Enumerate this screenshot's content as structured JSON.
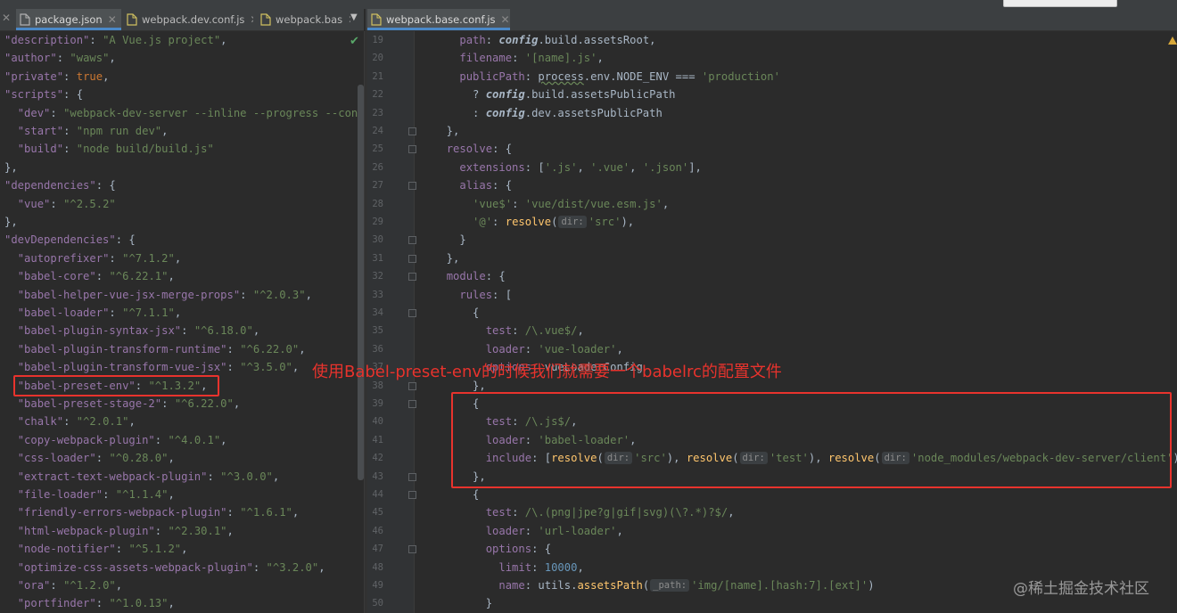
{
  "tabs_left": [
    {
      "label": "package.json",
      "icon": "json-file-icon",
      "active": true
    },
    {
      "label": "webpack.dev.conf.js",
      "icon": "js-file-icon",
      "active": false
    },
    {
      "label": "webpack.bas",
      "icon": "js-file-icon",
      "active": false
    }
  ],
  "tabs_right": [
    {
      "label": "webpack.base.conf.js",
      "icon": "js-file-icon",
      "active": true
    }
  ],
  "icons": {
    "close": "close-icon",
    "overflow": "chevron-down-icon",
    "check": "check-icon",
    "warning": "warning-icon"
  },
  "colors": {
    "background": "#2b2b2b",
    "key": "#9876aa",
    "string": "#6a8759",
    "keyword": "#cc7832",
    "number": "#6897bb",
    "function": "#ffc66d",
    "annotation": "#e8332d"
  },
  "editor_left": {
    "lines": [
      [
        [
          "k",
          "\"description\""
        ],
        [
          "p",
          ": "
        ],
        [
          "s",
          "\"A Vue.js project\""
        ],
        [
          "p",
          ","
        ]
      ],
      [
        [
          "k",
          "\"author\""
        ],
        [
          "p",
          ": "
        ],
        [
          "s",
          "\"waws\""
        ],
        [
          "p",
          ","
        ]
      ],
      [
        [
          "k",
          "\"private\""
        ],
        [
          "p",
          ": "
        ],
        [
          "kw",
          "true"
        ],
        [
          "p",
          ","
        ]
      ],
      [
        [
          "k",
          "\"scripts\""
        ],
        [
          "p",
          ": {"
        ]
      ],
      [
        [
          "p",
          "  "
        ],
        [
          "k",
          "\"dev\""
        ],
        [
          "p",
          ": "
        ],
        [
          "s",
          "\"webpack-dev-server --inline --progress --conf"
        ]
      ],
      [
        [
          "p",
          "  "
        ],
        [
          "k",
          "\"start\""
        ],
        [
          "p",
          ": "
        ],
        [
          "s",
          "\"npm run dev\""
        ],
        [
          "p",
          ","
        ]
      ],
      [
        [
          "p",
          "  "
        ],
        [
          "k",
          "\"build\""
        ],
        [
          "p",
          ": "
        ],
        [
          "s",
          "\"node build/build.js\""
        ]
      ],
      [
        [
          "p",
          "},"
        ]
      ],
      [
        [
          "k",
          "\"dependencies\""
        ],
        [
          "p",
          ": {"
        ]
      ],
      [
        [
          "p",
          "  "
        ],
        [
          "k",
          "\"vue\""
        ],
        [
          "p",
          ": "
        ],
        [
          "s",
          "\"^2.5.2\""
        ]
      ],
      [
        [
          "p",
          "},"
        ]
      ],
      [
        [
          "k",
          "\"devDependencies\""
        ],
        [
          "p",
          ": {"
        ]
      ],
      [
        [
          "p",
          "  "
        ],
        [
          "k",
          "\"autoprefixer\""
        ],
        [
          "p",
          ": "
        ],
        [
          "s",
          "\"^7.1.2\""
        ],
        [
          "p",
          ","
        ]
      ],
      [
        [
          "p",
          "  "
        ],
        [
          "k",
          "\"babel-core\""
        ],
        [
          "p",
          ": "
        ],
        [
          "s",
          "\"^6.22.1\""
        ],
        [
          "p",
          ","
        ]
      ],
      [
        [
          "p",
          "  "
        ],
        [
          "k",
          "\"babel-helper-vue-jsx-merge-props\""
        ],
        [
          "p",
          ": "
        ],
        [
          "s",
          "\"^2.0.3\""
        ],
        [
          "p",
          ","
        ]
      ],
      [
        [
          "p",
          "  "
        ],
        [
          "k",
          "\"babel-loader\""
        ],
        [
          "p",
          ": "
        ],
        [
          "s",
          "\"^7.1.1\""
        ],
        [
          "p",
          ","
        ]
      ],
      [
        [
          "p",
          "  "
        ],
        [
          "k",
          "\"babel-plugin-syntax-jsx\""
        ],
        [
          "p",
          ": "
        ],
        [
          "s",
          "\"^6.18.0\""
        ],
        [
          "p",
          ","
        ]
      ],
      [
        [
          "p",
          "  "
        ],
        [
          "k",
          "\"babel-plugin-transform-runtime\""
        ],
        [
          "p",
          ": "
        ],
        [
          "s",
          "\"^6.22.0\""
        ],
        [
          "p",
          ","
        ]
      ],
      [
        [
          "p",
          "  "
        ],
        [
          "k",
          "\"babel-plugin-transform-vue-jsx\""
        ],
        [
          "p",
          ": "
        ],
        [
          "s",
          "\"^3.5.0\""
        ],
        [
          "p",
          ","
        ]
      ],
      [
        [
          "p",
          "  "
        ],
        [
          "k",
          "\"babel-preset-env\""
        ],
        [
          "p",
          ": "
        ],
        [
          "s",
          "\"^1.3.2\""
        ],
        [
          "p",
          ","
        ]
      ],
      [
        [
          "p",
          "  "
        ],
        [
          "k",
          "\"babel-preset-stage-2\""
        ],
        [
          "p",
          ": "
        ],
        [
          "s",
          "\"^6.22.0\""
        ],
        [
          "p",
          ","
        ]
      ],
      [
        [
          "p",
          "  "
        ],
        [
          "k",
          "\"chalk\""
        ],
        [
          "p",
          ": "
        ],
        [
          "s",
          "\"^2.0.1\""
        ],
        [
          "p",
          ","
        ]
      ],
      [
        [
          "p",
          "  "
        ],
        [
          "k",
          "\"copy-webpack-plugin\""
        ],
        [
          "p",
          ": "
        ],
        [
          "s",
          "\"^4.0.1\""
        ],
        [
          "p",
          ","
        ]
      ],
      [
        [
          "p",
          "  "
        ],
        [
          "k",
          "\"css-loader\""
        ],
        [
          "p",
          ": "
        ],
        [
          "s",
          "\"^0.28.0\""
        ],
        [
          "p",
          ","
        ]
      ],
      [
        [
          "p",
          "  "
        ],
        [
          "k",
          "\"extract-text-webpack-plugin\""
        ],
        [
          "p",
          ": "
        ],
        [
          "s",
          "\"^3.0.0\""
        ],
        [
          "p",
          ","
        ]
      ],
      [
        [
          "p",
          "  "
        ],
        [
          "k",
          "\"file-loader\""
        ],
        [
          "p",
          ": "
        ],
        [
          "s",
          "\"^1.1.4\""
        ],
        [
          "p",
          ","
        ]
      ],
      [
        [
          "p",
          "  "
        ],
        [
          "k",
          "\"friendly-errors-webpack-plugin\""
        ],
        [
          "p",
          ": "
        ],
        [
          "s",
          "\"^1.6.1\""
        ],
        [
          "p",
          ","
        ]
      ],
      [
        [
          "p",
          "  "
        ],
        [
          "k",
          "\"html-webpack-plugin\""
        ],
        [
          "p",
          ": "
        ],
        [
          "s",
          "\"^2.30.1\""
        ],
        [
          "p",
          ","
        ]
      ],
      [
        [
          "p",
          "  "
        ],
        [
          "k",
          "\"node-notifier\""
        ],
        [
          "p",
          ": "
        ],
        [
          "s",
          "\"^5.1.2\""
        ],
        [
          "p",
          ","
        ]
      ],
      [
        [
          "p",
          "  "
        ],
        [
          "k",
          "\"optimize-css-assets-webpack-plugin\""
        ],
        [
          "p",
          ": "
        ],
        [
          "s",
          "\"^3.2.0\""
        ],
        [
          "p",
          ","
        ]
      ],
      [
        [
          "p",
          "  "
        ],
        [
          "k",
          "\"ora\""
        ],
        [
          "p",
          ": "
        ],
        [
          "s",
          "\"^1.2.0\""
        ],
        [
          "p",
          ","
        ]
      ],
      [
        [
          "p",
          "  "
        ],
        [
          "k",
          "\"portfinder\""
        ],
        [
          "p",
          ": "
        ],
        [
          "s",
          "\"^1.0.13\""
        ],
        [
          "p",
          ","
        ]
      ]
    ]
  },
  "editor_right": {
    "line_numbers": [
      "19",
      "20",
      "21",
      "22",
      "23",
      "24",
      "25",
      "26",
      "27",
      "28",
      "29",
      "30",
      "31",
      "32",
      "33",
      "34",
      "35",
      "36",
      "37",
      "38",
      "39",
      "40",
      "41",
      "42",
      "43",
      "44",
      "45",
      "46",
      "47",
      "48",
      "49",
      "50"
    ],
    "lines": [
      [
        [
          "p",
          "    "
        ],
        [
          "pr",
          "path"
        ],
        [
          "p",
          ": "
        ],
        [
          "it",
          "config"
        ],
        [
          "p",
          ".build.assetsRoot,"
        ]
      ],
      [
        [
          "p",
          "    "
        ],
        [
          "pr",
          "filename"
        ],
        [
          "p",
          ": "
        ],
        [
          "s",
          "'[name].js'"
        ],
        [
          "p",
          ","
        ]
      ],
      [
        [
          "p",
          "    "
        ],
        [
          "pr",
          "publicPath"
        ],
        [
          "p",
          ": "
        ],
        [
          "u",
          "process"
        ],
        [
          "p",
          ".env.NODE_ENV === "
        ],
        [
          "s",
          "'production'"
        ]
      ],
      [
        [
          "p",
          "      ? "
        ],
        [
          "it",
          "config"
        ],
        [
          "p",
          ".build.assetsPublicPath"
        ]
      ],
      [
        [
          "p",
          "      : "
        ],
        [
          "it",
          "config"
        ],
        [
          "p",
          ".dev.assetsPublicPath"
        ]
      ],
      [
        [
          "p",
          "  },"
        ]
      ],
      [
        [
          "p",
          "  "
        ],
        [
          "pr",
          "resolve"
        ],
        [
          "p",
          ": {"
        ]
      ],
      [
        [
          "p",
          "    "
        ],
        [
          "pr",
          "extensions"
        ],
        [
          "p",
          ": ["
        ],
        [
          "s",
          "'.js'"
        ],
        [
          "p",
          ", "
        ],
        [
          "s",
          "'.vue'"
        ],
        [
          "p",
          ", "
        ],
        [
          "s",
          "'.json'"
        ],
        [
          "p",
          "],"
        ]
      ],
      [
        [
          "p",
          "    "
        ],
        [
          "pr",
          "alias"
        ],
        [
          "p",
          ": {"
        ]
      ],
      [
        [
          "p",
          "      "
        ],
        [
          "s",
          "'vue$'"
        ],
        [
          "p",
          ": "
        ],
        [
          "s",
          "'vue/dist/vue.esm.js'"
        ],
        [
          "p",
          ","
        ]
      ],
      [
        [
          "p",
          "      "
        ],
        [
          "s",
          "'@'"
        ],
        [
          "p",
          ": "
        ],
        [
          "f",
          "resolve"
        ],
        [
          "p",
          "("
        ],
        [
          "h",
          "dir:"
        ],
        [
          "s",
          "'src'"
        ],
        [
          "p",
          "),"
        ]
      ],
      [
        [
          "p",
          "    }"
        ]
      ],
      [
        [
          "p",
          "  },"
        ]
      ],
      [
        [
          "p",
          "  "
        ],
        [
          "pr",
          "module"
        ],
        [
          "p",
          ": {"
        ]
      ],
      [
        [
          "p",
          "    "
        ],
        [
          "pr",
          "rules"
        ],
        [
          "p",
          ": ["
        ]
      ],
      [
        [
          "p",
          "      {"
        ]
      ],
      [
        [
          "p",
          "        "
        ],
        [
          "pr",
          "test"
        ],
        [
          "p",
          ": "
        ],
        [
          "s",
          "/\\.vue$/"
        ],
        [
          "p",
          ","
        ]
      ],
      [
        [
          "p",
          "        "
        ],
        [
          "pr",
          "loader"
        ],
        [
          "p",
          ": "
        ],
        [
          "s",
          "'vue-loader'"
        ],
        [
          "p",
          ","
        ]
      ],
      [
        [
          "p",
          "        "
        ],
        [
          "pr",
          "options"
        ],
        [
          "p",
          ": vueLoaderConfig"
        ]
      ],
      [
        [
          "p",
          "      },"
        ]
      ],
      [
        [
          "p",
          "      {"
        ]
      ],
      [
        [
          "p",
          "        "
        ],
        [
          "pr",
          "test"
        ],
        [
          "p",
          ": "
        ],
        [
          "s",
          "/\\.js$/"
        ],
        [
          "p",
          ","
        ]
      ],
      [
        [
          "p",
          "        "
        ],
        [
          "pr",
          "loader"
        ],
        [
          "p",
          ": "
        ],
        [
          "s",
          "'babel-loader'"
        ],
        [
          "p",
          ","
        ]
      ],
      [
        [
          "p",
          "        "
        ],
        [
          "pr",
          "include"
        ],
        [
          "p",
          ": ["
        ],
        [
          "f",
          "resolve"
        ],
        [
          "p",
          "("
        ],
        [
          "h",
          "dir:"
        ],
        [
          "s",
          "'src'"
        ],
        [
          "p",
          "), "
        ],
        [
          "f",
          "resolve"
        ],
        [
          "p",
          "("
        ],
        [
          "h",
          "dir:"
        ],
        [
          "s",
          "'test'"
        ],
        [
          "p",
          "), "
        ],
        [
          "f",
          "resolve"
        ],
        [
          "p",
          "("
        ],
        [
          "h",
          "dir:"
        ],
        [
          "s",
          "'node_modules/webpack-dev-server/client'"
        ],
        [
          "p",
          ")]"
        ]
      ],
      [
        [
          "p",
          "      },"
        ]
      ],
      [
        [
          "p",
          "      {"
        ]
      ],
      [
        [
          "p",
          "        "
        ],
        [
          "pr",
          "test"
        ],
        [
          "p",
          ": "
        ],
        [
          "s",
          "/\\.(png|jpe?g|gif|svg)(\\?.*)?$/"
        ],
        [
          "p",
          ","
        ]
      ],
      [
        [
          "p",
          "        "
        ],
        [
          "pr",
          "loader"
        ],
        [
          "p",
          ": "
        ],
        [
          "s",
          "'url-loader'"
        ],
        [
          "p",
          ","
        ]
      ],
      [
        [
          "p",
          "        "
        ],
        [
          "pr",
          "options"
        ],
        [
          "p",
          ": {"
        ]
      ],
      [
        [
          "p",
          "          "
        ],
        [
          "pr",
          "limit"
        ],
        [
          "p",
          ": "
        ],
        [
          "n",
          "10000"
        ],
        [
          "p",
          ","
        ]
      ],
      [
        [
          "p",
          "          "
        ],
        [
          "pr",
          "name"
        ],
        [
          "p",
          ": utils."
        ],
        [
          "f",
          "assetsPath"
        ],
        [
          "p",
          "("
        ],
        [
          "h",
          "_path:"
        ],
        [
          "s",
          "'img/[name].[hash:7].[ext]'"
        ],
        [
          "p",
          ")"
        ]
      ],
      [
        [
          "p",
          "        }"
        ]
      ]
    ]
  },
  "annotation": {
    "text": "使用Babel-preset-env的时候我们就需要一个babelrc的配置文件"
  },
  "watermark": {
    "text": "@稀土掘金技术社区"
  }
}
